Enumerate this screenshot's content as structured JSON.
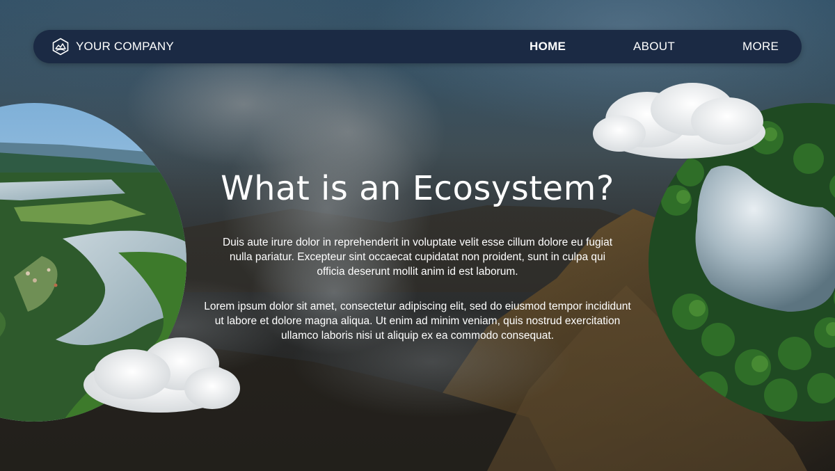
{
  "nav": {
    "brand": "YOUR COMPANY",
    "brand_icon": "company-logo-icon",
    "links": [
      {
        "label": "HOME",
        "active": true
      },
      {
        "label": "ABOUT",
        "active": false
      },
      {
        "label": "MORE",
        "active": false
      }
    ]
  },
  "hero": {
    "title": "What is an Ecosystem?",
    "paragraphs": [
      "Duis aute irure dolor in reprehenderit in voluptate velit esse cillum dolore eu fugiat nulla pariatur. Excepteur sint occaecat cupidatat non proident, sunt in culpa qui officia deserunt mollit anim id est laborum.",
      "Lorem ipsum dolor sit amet, consectetur adipiscing elit, sed do eiusmod tempor incididunt ut labore et dolore magna aliqua. Ut enim ad minim veniam, quis nostrud exercitation ullamco laboris nisi ut aliquip ex ea commodo consequat."
    ]
  },
  "images": {
    "left": "lake-valley-aerial",
    "right": "forest-lake-aerial",
    "background": "volcanic-mountain-clouds"
  },
  "colors": {
    "nav_bg": "#1b2a44",
    "text": "#ffffff"
  }
}
